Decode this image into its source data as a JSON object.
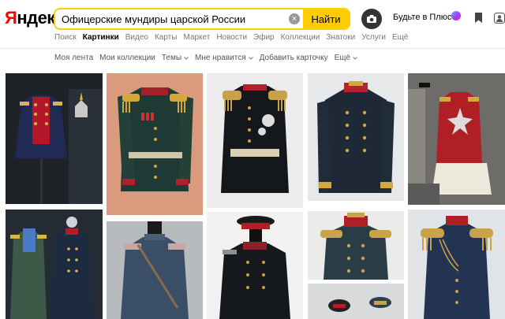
{
  "header": {
    "logo_first": "Я",
    "logo_rest": "ндекс",
    "search_value": "Офицерские мундиры царской России",
    "search_button": "Найти",
    "plus_link": "Будьте в Плюсе"
  },
  "tabs": [
    "Поиск",
    "Картинки",
    "Видео",
    "Карты",
    "Маркет",
    "Новости",
    "Эфир",
    "Коллекции",
    "Знатоки",
    "Услуги",
    "Ещё"
  ],
  "active_tab": "Картинки",
  "subnav": [
    {
      "label": "Моя лента",
      "dropdown": false
    },
    {
      "label": "Мои коллекции",
      "dropdown": false
    },
    {
      "label": "Темы",
      "dropdown": true
    },
    {
      "label": "Мне нравится",
      "dropdown": true
    },
    {
      "label": "Добавить карточку",
      "dropdown": false
    },
    {
      "label": "Ещё",
      "dropdown": true
    }
  ],
  "colors": {
    "brand_red": "#ff0000",
    "accent_yellow": "#ffcc00"
  }
}
